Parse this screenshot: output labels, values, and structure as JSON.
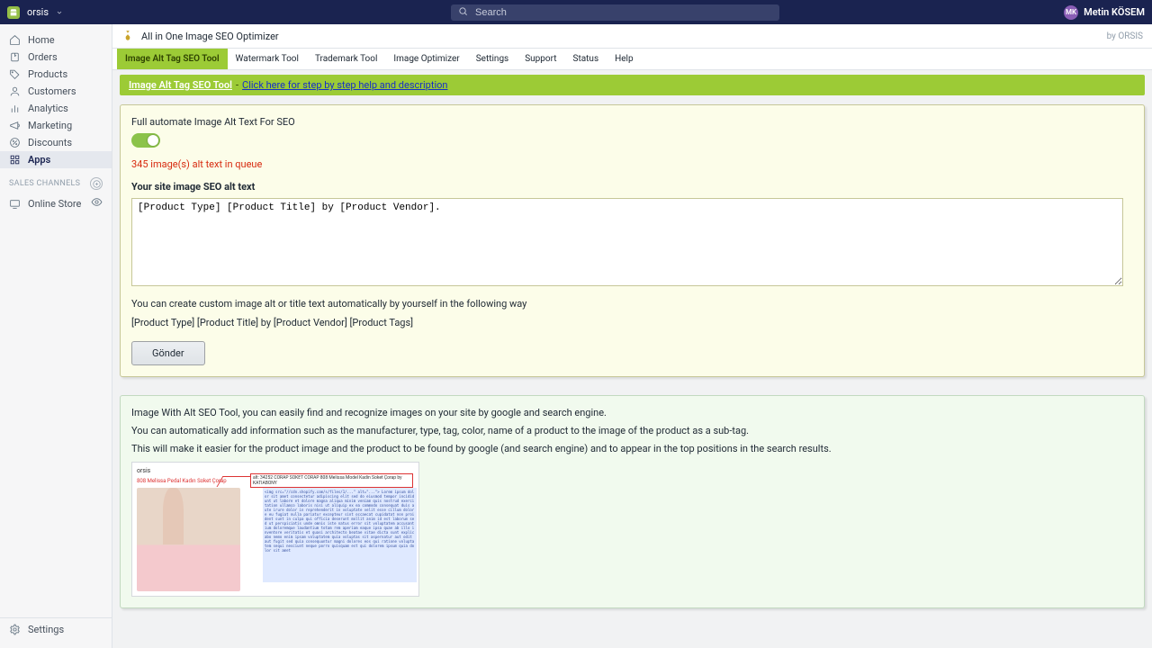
{
  "topbar": {
    "shop_name": "orsis",
    "search_placeholder": "Search",
    "user_initials": "MK",
    "user_name": "Metin KÖSEM"
  },
  "sidebar": {
    "items": [
      {
        "key": "home",
        "label": "Home"
      },
      {
        "key": "orders",
        "label": "Orders"
      },
      {
        "key": "products",
        "label": "Products"
      },
      {
        "key": "customers",
        "label": "Customers"
      },
      {
        "key": "analytics",
        "label": "Analytics"
      },
      {
        "key": "marketing",
        "label": "Marketing"
      },
      {
        "key": "discounts",
        "label": "Discounts"
      },
      {
        "key": "apps",
        "label": "Apps"
      }
    ],
    "section_label": "SALES CHANNELS",
    "channels": [
      {
        "key": "online-store",
        "label": "Online Store"
      }
    ],
    "footer_label": "Settings"
  },
  "app_header": {
    "title": "All in One Image SEO Optimizer",
    "byline": "by ORSIS"
  },
  "tool_tabs": [
    "Image Alt Tag SEO Tool",
    "Watermark Tool",
    "Trademark Tool",
    "Image Optimizer",
    "Settings",
    "Support",
    "Status",
    "Help"
  ],
  "banner": {
    "title": "Image Alt Tag SEO Tool",
    "sep": "-",
    "link_text": "Click here for step by step help and description"
  },
  "form": {
    "automate_label": "Full automate Image Alt Text For SEO",
    "queue_msg": "345 image(s) alt text in queue",
    "alt_label": "Your site image SEO alt text",
    "alt_value": "[Product Type] [Product Title] by [Product Vendor].",
    "hint": "You can create custom image alt or title text automatically by yourself in the following way",
    "template_example": "[Product Type] [Product Title] by [Product Vendor] [Product Tags]",
    "submit_label": "Gönder"
  },
  "info": {
    "p1": "Image With Alt SEO Tool, you can easily find and recognize images on your site by google and search engine.",
    "p2": "You can automatically add information such as the manufacturer, type, tag, color, name of a product to the image of the product as a sub-tag.",
    "p3": "This will make it easier for the product image and the product to be found by google (and search engine) and to appear in the top positions in the search results.",
    "demo_brand": "orsis",
    "demo_alt": "alt: 34252 CORAP SOKET CORAP 808 Melissa Model Kadin Soket Çorap by KATIABONY"
  }
}
